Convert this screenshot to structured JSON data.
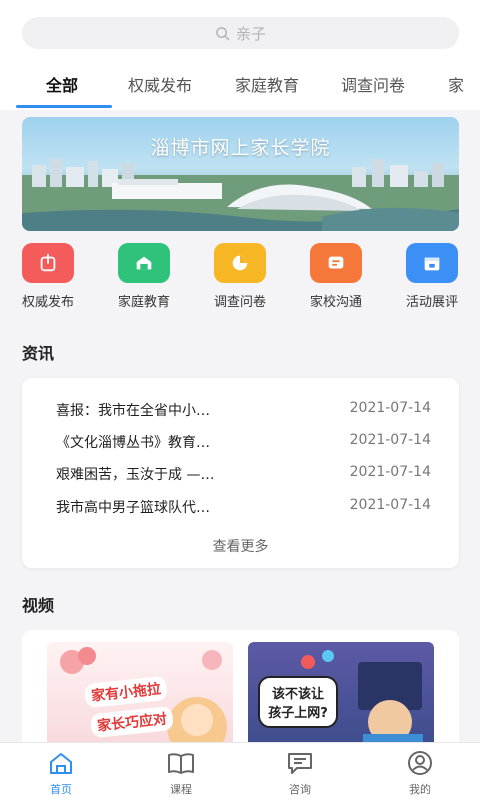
{
  "search": {
    "placeholder": "亲子"
  },
  "tabs": [
    {
      "label": "全部",
      "active": true
    },
    {
      "label": "权威发布"
    },
    {
      "label": "家庭教育"
    },
    {
      "label": "调查问卷"
    },
    {
      "label": "家"
    }
  ],
  "banner": {
    "title": "淄博市网上家长学院"
  },
  "quick_links": [
    {
      "label": "权威发布",
      "icon": "megaphone-icon",
      "color": "#f45c5c"
    },
    {
      "label": "家庭教育",
      "icon": "home-icon",
      "color": "#2fc27a"
    },
    {
      "label": "调查问卷",
      "icon": "pie-chart-icon",
      "color": "#f7b623"
    },
    {
      "label": "家校沟通",
      "icon": "message-icon",
      "color": "#f5783a"
    },
    {
      "label": "活动展评",
      "icon": "calendar-icon",
      "color": "#3b8ff5"
    }
  ],
  "news": {
    "section_title": "资讯",
    "items": [
      {
        "title": "喜报：我市在全省中小…",
        "date": "2021-07-14"
      },
      {
        "title": "《文化淄博丛书》教育…",
        "date": "2021-07-14"
      },
      {
        "title": "艰难困苦，玉汝于成 —…",
        "date": "2021-07-14"
      },
      {
        "title": "我市高中男子篮球队代…",
        "date": "2021-07-14"
      }
    ],
    "more_label": "查看更多"
  },
  "videos": {
    "section_title": "视频",
    "items": [
      {
        "line1": "家有小拖拉",
        "line2": "家长巧应对"
      },
      {
        "caption": "该不该让孩子上网?"
      }
    ]
  },
  "bottom_nav": [
    {
      "label": "首页",
      "icon": "home-icon",
      "active": true
    },
    {
      "label": "课程",
      "icon": "book-icon"
    },
    {
      "label": "咨询",
      "icon": "chat-icon"
    },
    {
      "label": "我的",
      "icon": "user-icon"
    }
  ],
  "colors": {
    "accent": "#2f8ef0"
  }
}
